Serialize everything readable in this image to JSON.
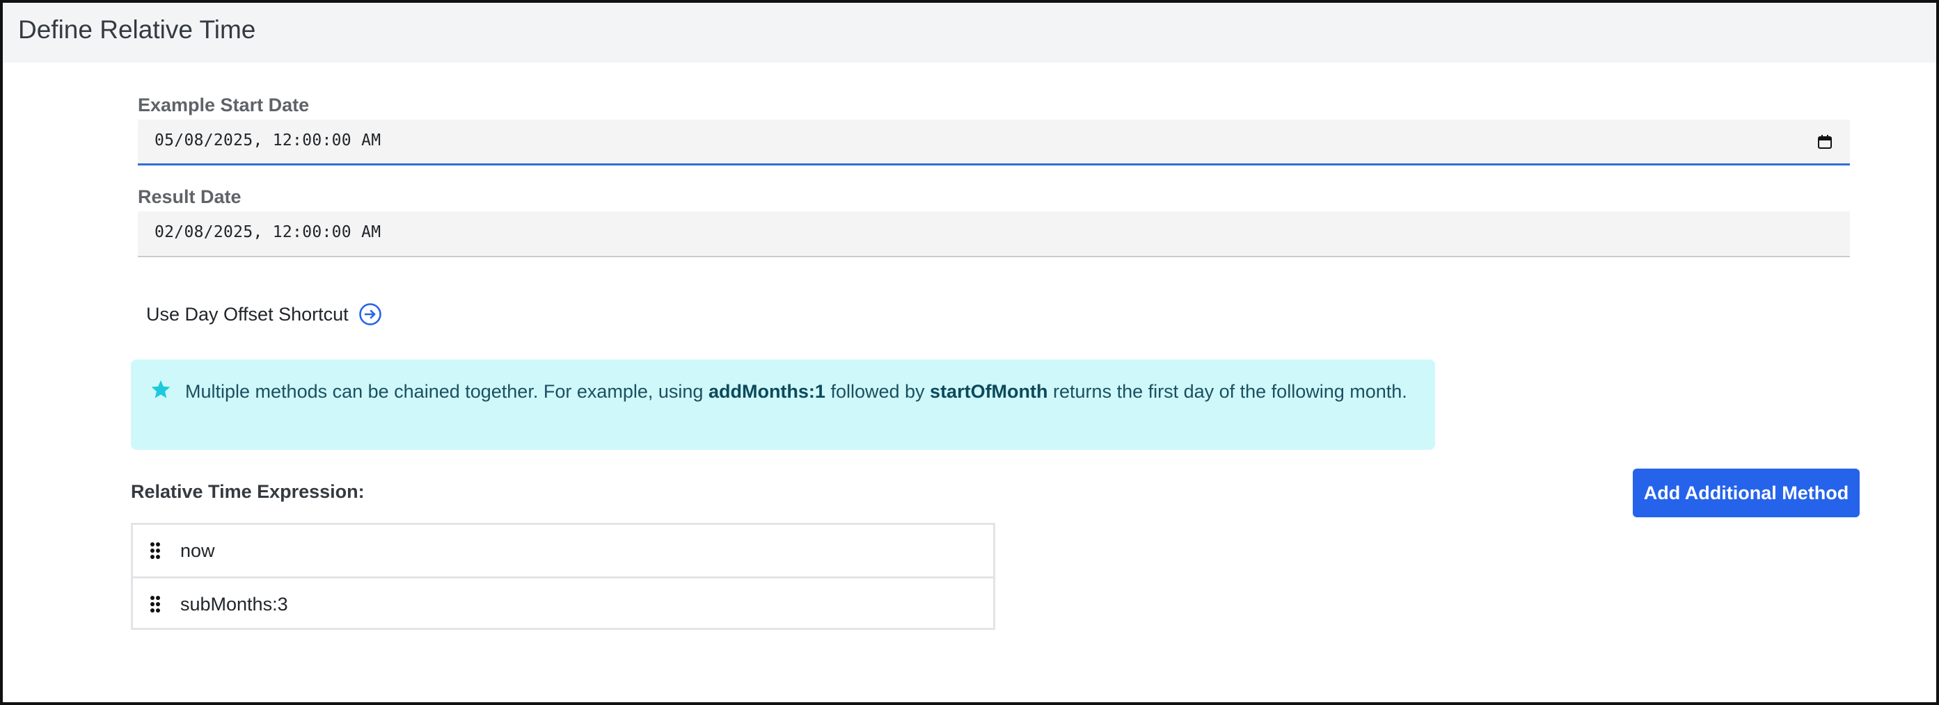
{
  "header": {
    "title": "Define Relative Time"
  },
  "start_date": {
    "label": "Example Start Date",
    "value": "05/08/2025, 12:00:00 AM",
    "icon": "calendar-icon"
  },
  "result_date": {
    "label": "Result Date",
    "value": "02/08/2025, 12:00:00 AM"
  },
  "shortcut": {
    "label": "Use Day Offset Shortcut",
    "icon": "arrow-right-circle-icon"
  },
  "info": {
    "icon": "star-icon",
    "text_1": "Multiple methods can be chained together. For example, using ",
    "method_1": "addMonths:1",
    "text_2": " followed by ",
    "method_2": "startOfMonth",
    "text_3": " returns the first day of the following month."
  },
  "expression": {
    "label": "Relative Time Expression:",
    "add_button_label": "Add Additional Method",
    "items": [
      {
        "text": "now"
      },
      {
        "text": "subMonths:3"
      }
    ]
  },
  "colors": {
    "accent": "#2563eb",
    "info_bg": "#cff8fb",
    "header_bg": "#f3f4f6"
  }
}
